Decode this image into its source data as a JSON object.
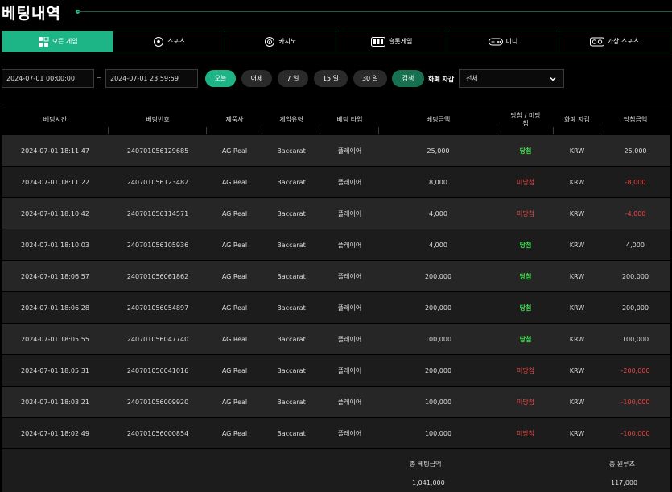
{
  "page": {
    "title": "베팅내역"
  },
  "tabs": [
    {
      "label": "모든 게임",
      "icon": "grid-icon",
      "active": true
    },
    {
      "label": "스포츠",
      "icon": "soccer-ball-icon",
      "active": false
    },
    {
      "label": "카지노",
      "icon": "casino-chip-icon",
      "active": false
    },
    {
      "label": "슬롯게임",
      "icon": "slot-machine-icon",
      "active": false
    },
    {
      "label": "미니",
      "icon": "gamepad-icon",
      "active": false
    },
    {
      "label": "가상 스포츠",
      "icon": "virtual-sports-icon",
      "active": false
    }
  ],
  "filters": {
    "start_date": "2024-07-01 00:00:00",
    "tilde": "~",
    "end_date": "2024-07-01 23:59:59",
    "today": "오늘",
    "yesterday": "어제",
    "d7": "7 일",
    "d15": "15 일",
    "d30": "30 일",
    "search": "검색",
    "currency_label": "화폐 자갑",
    "currency_value": "전체"
  },
  "table": {
    "headers": [
      "베팅시간",
      "베팅번호",
      "제품사",
      "게임유형",
      "베팅 타입",
      "베팅금액",
      "당첨 / 미당첨",
      "화폐 자갑",
      "당첨금액"
    ],
    "rows": [
      [
        "2024-07-01 18:11:47",
        "240701056129685",
        "AG Real",
        "Baccarat",
        "플레이어",
        "25,000",
        "당첨",
        "KRW",
        "25,000"
      ],
      [
        "2024-07-01 18:11:22",
        "240701056123482",
        "AG Real",
        "Baccarat",
        "플레이어",
        "8,000",
        "미당첨",
        "KRW",
        "-8,000"
      ],
      [
        "2024-07-01 18:10:42",
        "240701056114571",
        "AG Real",
        "Baccarat",
        "플레이어",
        "4,000",
        "미당첨",
        "KRW",
        "-4,000"
      ],
      [
        "2024-07-01 18:10:03",
        "240701056105936",
        "AG Real",
        "Baccarat",
        "플레이어",
        "4,000",
        "당첨",
        "KRW",
        "4,000"
      ],
      [
        "2024-07-01 18:06:57",
        "240701056061862",
        "AG Real",
        "Baccarat",
        "플레이어",
        "200,000",
        "당첨",
        "KRW",
        "200,000"
      ],
      [
        "2024-07-01 18:06:28",
        "240701056054897",
        "AG Real",
        "Baccarat",
        "플레이어",
        "200,000",
        "당첨",
        "KRW",
        "200,000"
      ],
      [
        "2024-07-01 18:05:55",
        "240701056047740",
        "AG Real",
        "Baccarat",
        "플레이어",
        "100,000",
        "당첨",
        "KRW",
        "100,000"
      ],
      [
        "2024-07-01 18:05:31",
        "240701056041016",
        "AG Real",
        "Baccarat",
        "플레이어",
        "200,000",
        "미당첨",
        "KRW",
        "-200,000"
      ],
      [
        "2024-07-01 18:03:21",
        "240701056009920",
        "AG Real",
        "Baccarat",
        "플레이어",
        "100,000",
        "미당첨",
        "KRW",
        "-100,000"
      ],
      [
        "2024-07-01 18:02:49",
        "240701056000854",
        "AG Real",
        "Baccarat",
        "플레이어",
        "100,000",
        "미당첨",
        "KRW",
        "-100,000"
      ]
    ]
  },
  "footer": {
    "total_bet_label": "총 베팅금액",
    "total_bet_value": "1,041,000",
    "total_win_label": "총 윈루즈",
    "total_win_value": "117,000"
  },
  "colors": {
    "accent": "#1db586",
    "win": "#3ddc4a",
    "lose": "#e84545"
  }
}
